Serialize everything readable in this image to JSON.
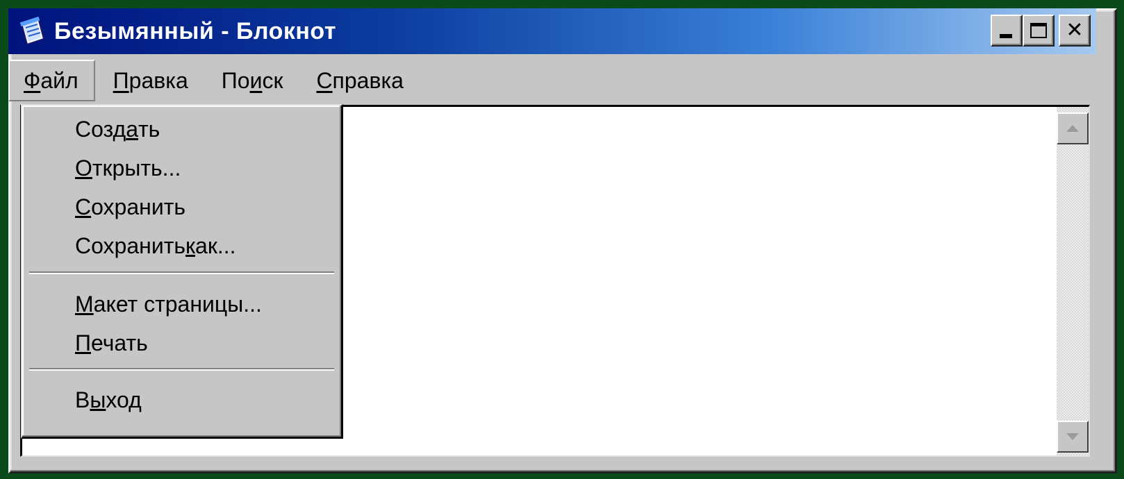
{
  "window": {
    "title": "Безымянный - Блокнот",
    "icons": {
      "app": "notepad-icon",
      "minimize": "minimize-icon",
      "maximize": "maximize-icon",
      "close": "close-icon",
      "close_glyph": "✕",
      "up": "scroll-up-arrow-icon",
      "down": "scroll-down-arrow-icon"
    }
  },
  "menubar": {
    "file": {
      "mnemonic": "Ф",
      "rest": "айл"
    },
    "edit": {
      "mnemonic": "П",
      "rest": "равка"
    },
    "search": {
      "pre": "По",
      "mnemonic": "и",
      "rest": "ск"
    },
    "help": {
      "mnemonic": "С",
      "rest": "правка"
    }
  },
  "file_menu": {
    "new": {
      "pre": "Созд",
      "mnemonic": "а",
      "rest": "ть"
    },
    "open": {
      "mnemonic": "О",
      "rest": "ткрыть..."
    },
    "save": {
      "mnemonic": "С",
      "rest": "охранить"
    },
    "save_as": {
      "pre": "Сохранить ",
      "mnemonic": "к",
      "rest": "ак..."
    },
    "page_setup": {
      "mnemonic": "М",
      "rest": "акет страницы..."
    },
    "print": {
      "mnemonic": "П",
      "rest": "ечать"
    },
    "exit": {
      "pre": "В",
      "mnemonic": "ы",
      "rest": "ход"
    }
  },
  "editor": {
    "content": ""
  },
  "colors": {
    "desktop": "#0b4a1a",
    "titlebar_start": "#00127d",
    "titlebar_end": "#a6caf0",
    "face": "#c6c6c6"
  }
}
